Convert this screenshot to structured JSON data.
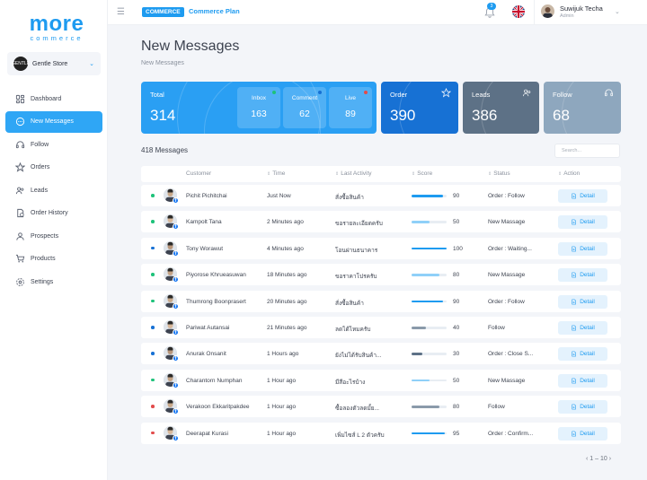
{
  "brand": {
    "name": "more",
    "tagline": "commerce"
  },
  "store": {
    "name": "Gentle Store",
    "avatar_text": "GENTLE"
  },
  "sidebar": {
    "items": [
      {
        "label": "Dashboard",
        "icon": "dashboard-icon"
      },
      {
        "label": "New Messages",
        "icon": "message-icon",
        "active": true
      },
      {
        "label": "Follow",
        "icon": "headset-icon"
      },
      {
        "label": "Orders",
        "icon": "star-icon"
      },
      {
        "label": "Leads",
        "icon": "users-icon"
      },
      {
        "label": "Order History",
        "icon": "history-icon"
      },
      {
        "label": "Prospects",
        "icon": "user-icon"
      },
      {
        "label": "Products",
        "icon": "cart-icon"
      },
      {
        "label": "Settings",
        "icon": "settings-icon"
      }
    ]
  },
  "topbar": {
    "badge": "COMMERCE",
    "plan": "Commerce Plan",
    "notifications": "3",
    "user_name": "Suwijuk Techa",
    "user_role": "Admin"
  },
  "page": {
    "title": "New Messages",
    "breadcrumb": "New Messages"
  },
  "summary": {
    "total_label": "Total",
    "total_value": "314",
    "inbox_label": "Inbox",
    "inbox_value": "163",
    "comment_label": "Comment",
    "comment_value": "62",
    "live_label": "Live",
    "live_value": "89",
    "order_label": "Order",
    "order_value": "390",
    "leads_label": "Leads",
    "leads_value": "386",
    "follow_label": "Follow",
    "follow_value": "68"
  },
  "list": {
    "count_text": "418 Messages",
    "search_placeholder": "Search..."
  },
  "table": {
    "headers": {
      "customer": "Customer",
      "time": "Time",
      "activity": "Last Activity",
      "score": "Score",
      "status": "Status",
      "action": "Action"
    },
    "detail_label": "Detail",
    "rows": [
      {
        "name": "Pichit Pichitchai",
        "time": "Just Now",
        "activity": "สั่งซื้อสินค้า",
        "score": 90,
        "status": "Order : Follow",
        "dot": "#1ec27a",
        "bar": "#1e9bf0"
      },
      {
        "name": "Kampolt Tana",
        "time": "2 Minutes ago",
        "activity": "ขอรายละเอียดครับ",
        "score": 50,
        "status": "New Massage",
        "dot": "#1ec27a",
        "bar": "#8fd0f8"
      },
      {
        "name": "Tony Worawut",
        "time": "4 Minutes ago",
        "activity": "โอนผ่านธนาคาร",
        "score": 100,
        "status": "Order : Waiting...",
        "dot": "#1771d4",
        "bar": "#1e9bf0"
      },
      {
        "name": "Piyorose Khrueasuwan",
        "time": "18 Minutes ago",
        "activity": "ขอราคาโปรครับ",
        "score": 80,
        "status": "New Massage",
        "dot": "#1ec27a",
        "bar": "#8fd0f8"
      },
      {
        "name": "Thumrong Boonprasert",
        "time": "20 Minutes ago",
        "activity": "สั่งซื้อสินค้า",
        "score": 90,
        "status": "Order : Follow",
        "dot": "#1ec27a",
        "bar": "#1e9bf0"
      },
      {
        "name": "Pariwat Autansai",
        "time": "21 Minutes ago",
        "activity": "ลดได้ไหมครับ",
        "score": 40,
        "status": "Follow",
        "dot": "#1771d4",
        "bar": "#8a9aaa"
      },
      {
        "name": "Anurak  Onsanit",
        "time": "1 Hours ago",
        "activity": "ยังไม่ได้รับสินค้า...",
        "score": 30,
        "status": "Order : Close S...",
        "dot": "#1771d4",
        "bar": "#5d7186"
      },
      {
        "name": "Charantorn Numphan",
        "time": "1 Hour ago",
        "activity": "มีสีอะไรบ้าง",
        "score": 50,
        "status": "New Massage",
        "dot": "#1ec27a",
        "bar": "#8fd0f8"
      },
      {
        "name": "Verakoon Ekkaritpakdee",
        "time": "1 Hour ago",
        "activity": "ซื้อลองตัวลดมั้ย...",
        "score": 80,
        "status": "Follow",
        "dot": "#e24c4c",
        "bar": "#8a9aaa"
      },
      {
        "name": "Deerapat Kurasi",
        "time": "1 Hour ago",
        "activity": "เพิ่มไซส์ L 2 ตัวครับ",
        "score": 95,
        "status": "Order : Confirm...",
        "dot": "#e24c4c",
        "bar": "#1e9bf0"
      }
    ]
  },
  "pagination": {
    "text": "1 – 10"
  }
}
